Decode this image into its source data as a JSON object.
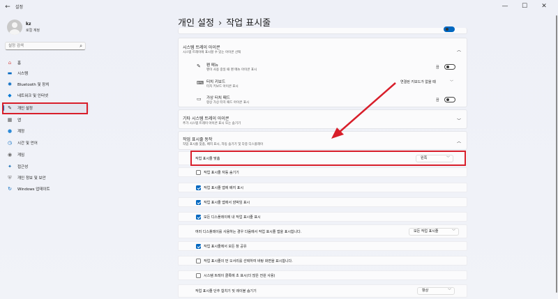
{
  "window": {
    "title": "설정",
    "back": "←",
    "minimize": "—",
    "maximize": "☐",
    "close": "✕"
  },
  "user": {
    "name": "kz",
    "subtitle": "로컬 계정"
  },
  "search": {
    "placeholder": "설정 검색",
    "icon": "⌕"
  },
  "sidebar": {
    "items": [
      {
        "label": "홈",
        "icon": "⌂",
        "color": "#d9534f"
      },
      {
        "label": "시스템",
        "icon": "▬",
        "color": "#0067c0"
      },
      {
        "label": "Bluetooth 및 장치",
        "icon": "✱",
        "color": "#0067c0"
      },
      {
        "label": "네트워크 및 인터넷",
        "icon": "◆",
        "color": "#0078d4"
      },
      {
        "label": "개인 설정",
        "icon": "✎",
        "color": "#333333",
        "selected": true
      },
      {
        "label": "앱",
        "icon": "▦",
        "color": "#555555"
      },
      {
        "label": "계정",
        "icon": "●",
        "color": "#2e8bd8"
      },
      {
        "label": "시간 및 언어",
        "icon": "◷",
        "color": "#0067c0"
      },
      {
        "label": "게임",
        "icon": "◉",
        "color": "#666666"
      },
      {
        "label": "접근성",
        "icon": "✦",
        "color": "#1a6fb5"
      },
      {
        "label": "개인 정보 및 보안",
        "icon": "⛨",
        "color": "#777777"
      },
      {
        "label": "Windows 업데이트",
        "icon": "↻",
        "color": "#0067c0"
      }
    ]
  },
  "breadcrumb": {
    "parent": "개인 설정",
    "separator": "›",
    "current": "작업 표시줄"
  },
  "tray": {
    "title": "시스템 트레이 아이콘",
    "desc": "시스템 트레이에 표시할 수 있는 아이콘 선택",
    "items": [
      {
        "title": "펜 메뉴",
        "desc": "펜이 사용 중일 때 펜 메뉴 아이콘 표시",
        "state": "끔",
        "icon": "✎"
      },
      {
        "title": "터치 키보드",
        "desc": "터치 키보드 아이콘 표시",
        "value": "연결된 키보드가 없을 때",
        "icon": "⌨"
      },
      {
        "title": "가상 터치 패드",
        "desc": "항상 가상 터치 패드 아이콘 표시",
        "state": "끔",
        "icon": "▭"
      }
    ]
  },
  "other_tray": {
    "title": "기타 시스템 트레이 아이콘",
    "desc": "추가 시스템 트레이 아이콘 표시 또는 숨기기"
  },
  "behaviors": {
    "title": "작업 표시줄 동작",
    "desc": "작업 표시줄 맞춤, 배지 표시, 자동 숨기기 및 다중 디스플레이",
    "alignment_label": "작업 표시줄 맞춤",
    "alignment_value": "왼쪽",
    "checkboxes_a": [
      {
        "label": "작업 표시줄 자동 숨기기",
        "checked": false
      },
      {
        "label": "작업 표시줄 앱에 배지 표시",
        "checked": true
      },
      {
        "label": "작업 표시줄 앱에서 깜박임 표시",
        "checked": true
      },
      {
        "label": "모든 디스플레이에 내 작업 표시줄 표시",
        "checked": true
      }
    ],
    "multi_display_label": "여러 디스플레이를 사용하는 경우 다음에서 작업 표시줄 앱을 표시합니다.",
    "multi_display_value": "모든 작업 표시줄",
    "checkboxes_b": [
      {
        "label": "작업 표시줄에서 모든 창 공유",
        "checked": true
      },
      {
        "label": "작업 표시줄의 먼 오서리를 선택하여 바탕 화면을 표시합니다.",
        "checked": false
      },
      {
        "label": "시스템 트레이 클록에 초 표시(더 많은 전원 사용)",
        "checked": false
      }
    ],
    "combine_label": "작업 표시줄 단추 합치기 및 레이블 숨기기",
    "combine_value": "항상"
  }
}
